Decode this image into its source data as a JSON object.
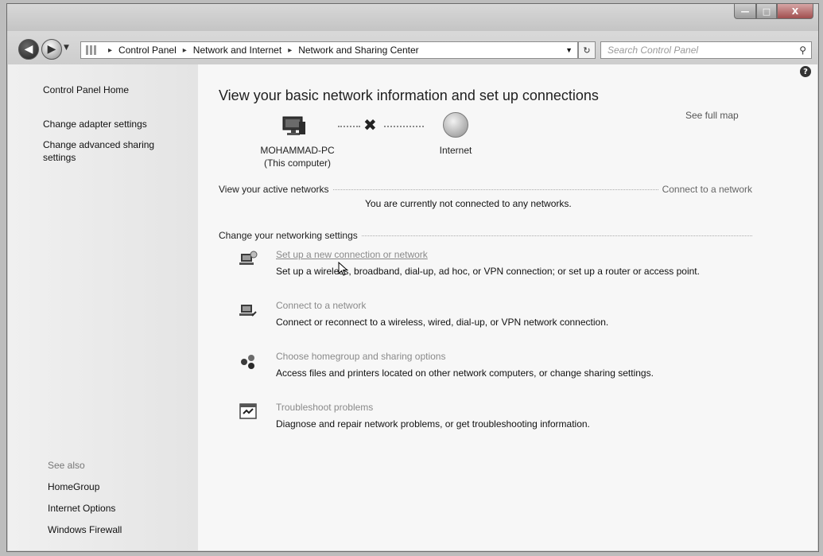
{
  "window": {
    "controls": {
      "minimize": "—",
      "maximize": "□",
      "close": "X"
    }
  },
  "navbar": {
    "breadcrumb": [
      "Control Panel",
      "Network and Internet",
      "Network and Sharing Center"
    ],
    "breadcrumb_separator": "▸",
    "search_placeholder": "Search Control Panel",
    "icons": {
      "back": "back-arrow-icon",
      "forward": "forward-arrow-icon",
      "refresh": "refresh-icon",
      "search": "search-icon"
    }
  },
  "sidebar": {
    "home": "Control Panel Home",
    "items": [
      "Change adapter settings",
      "Change advanced sharing settings"
    ],
    "see_also_heading": "See also",
    "see_also": [
      "HomeGroup",
      "Internet Options",
      "Windows Firewall"
    ]
  },
  "main": {
    "heading": "View your basic network information and set up connections",
    "see_full_map": "See full map",
    "map": {
      "computer_name": "MOHAMMAD-PC",
      "computer_sub": "(This computer)",
      "internet_label": "Internet",
      "status": "disconnected"
    },
    "active_networks_label": "View your active networks",
    "connect_link": "Connect to a network",
    "not_connected_text": "You are currently not connected to any networks.",
    "change_settings_label": "Change your networking settings",
    "tasks": [
      {
        "title": "Set up a new connection or network",
        "desc": "Set up a wireless, broadband, dial-up, ad hoc, or VPN connection; or set up a router or access point.",
        "icon": "network-setup-icon"
      },
      {
        "title": "Connect to a network",
        "desc": "Connect or reconnect to a wireless, wired, dial-up, or VPN network connection.",
        "icon": "network-connect-icon"
      },
      {
        "title": "Choose homegroup and sharing options",
        "desc": "Access files and printers located on other network computers, or change sharing settings.",
        "icon": "homegroup-icon"
      },
      {
        "title": "Troubleshoot problems",
        "desc": "Diagnose and repair network problems, or get troubleshooting information.",
        "icon": "troubleshoot-icon"
      }
    ]
  }
}
